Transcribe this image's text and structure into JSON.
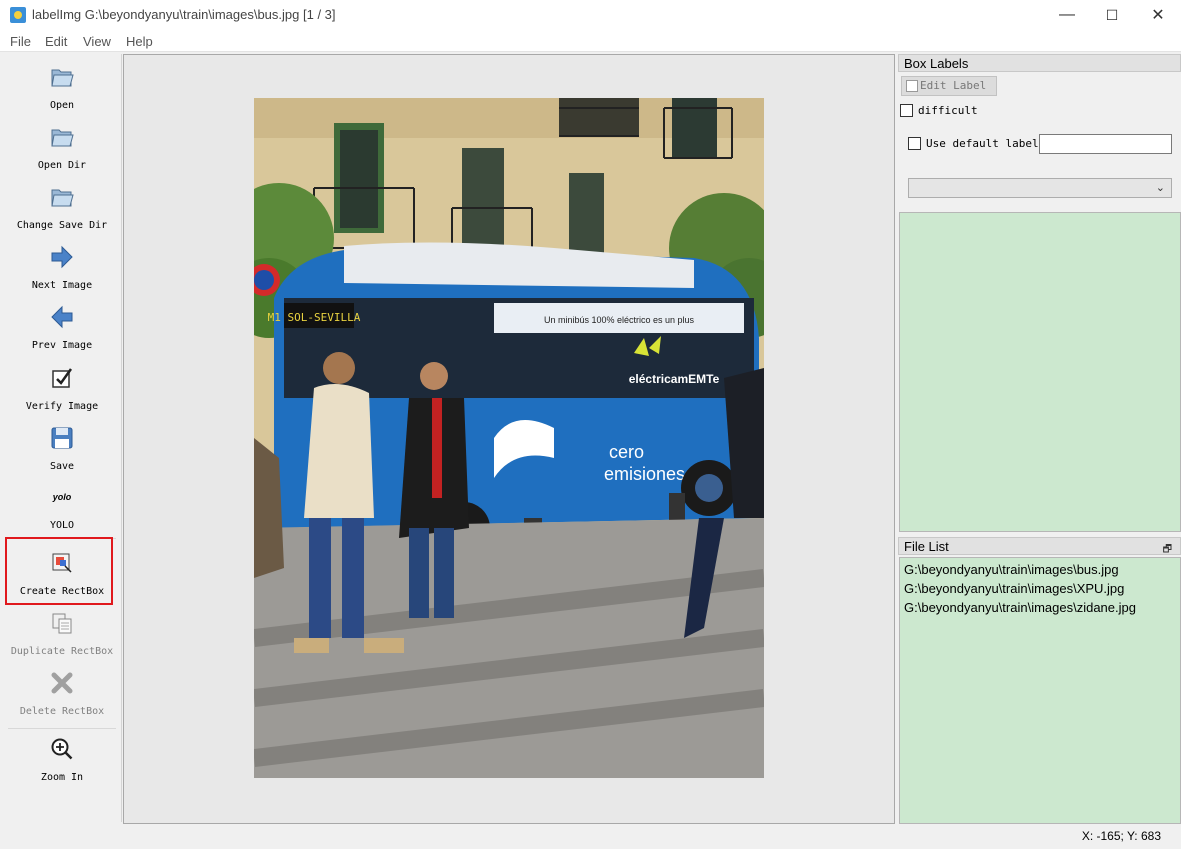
{
  "window": {
    "title": "labelImg G:\\beyondyanyu\\train\\images\\bus.jpg [1 / 3]",
    "minimize": "—",
    "maximize": "☐",
    "close": "✕"
  },
  "menu": [
    "File",
    "Edit",
    "View",
    "Help"
  ],
  "toolbar": {
    "tools": [
      {
        "id": "open",
        "label": "Open",
        "icon": "folder-icon",
        "enabled": true
      },
      {
        "id": "open-dir",
        "label": "Open Dir",
        "icon": "folder-icon",
        "enabled": true
      },
      {
        "id": "change-save-dir",
        "label": "Change Save Dir",
        "icon": "folder-icon",
        "enabled": true
      },
      {
        "id": "next-image",
        "label": "Next Image",
        "icon": "arrow-right-icon",
        "enabled": true
      },
      {
        "id": "prev-image",
        "label": "Prev Image",
        "icon": "arrow-left-icon",
        "enabled": true
      },
      {
        "id": "verify-image",
        "label": "Verify Image",
        "icon": "checkbox-icon",
        "enabled": true
      },
      {
        "id": "save",
        "label": "Save",
        "icon": "floppy-icon",
        "enabled": true
      },
      {
        "id": "yolo",
        "label": "YOLO",
        "icon_text": "yolo",
        "icon": "yolo-icon",
        "enabled": true
      },
      {
        "id": "create-rectbox",
        "label": "Create RectBox",
        "icon": "draw-rect-icon",
        "enabled": true
      },
      {
        "id": "duplicate-rectbox",
        "label": "Duplicate RectBox",
        "icon": "copy-icon",
        "enabled": false
      },
      {
        "id": "delete-rectbox",
        "label": "Delete RectBox",
        "icon": "delete-icon",
        "enabled": false
      },
      {
        "id": "zoom-in",
        "label": "Zoom In",
        "icon": "zoom-in-icon",
        "enabled": true
      }
    ],
    "more": "»"
  },
  "box_labels": {
    "title": "Box Labels",
    "edit_label": "Edit Label",
    "difficult_label": "difficult",
    "difficult_checked": false,
    "use_default_label": "Use default label",
    "use_default_checked": false,
    "default_label_value": "",
    "label_combo_value": ""
  },
  "file_list": {
    "title": "File List",
    "files": [
      "G:\\beyondyanyu\\train\\images\\bus.jpg",
      "G:\\beyondyanyu\\train\\images\\XPU.jpg",
      "G:\\beyondyanyu\\train\\images\\zidane.jpg"
    ]
  },
  "photo": {
    "bus_sign": "M1 SOL-SEVILLA",
    "bus_slogan": "Un minibús 100% eléctrico es un plus",
    "bus_brand": "eléctricamEMTe",
    "bus_text_1": "cero",
    "bus_text_2": "emisiones"
  },
  "status": {
    "coords": "X: -165; Y: 683"
  }
}
